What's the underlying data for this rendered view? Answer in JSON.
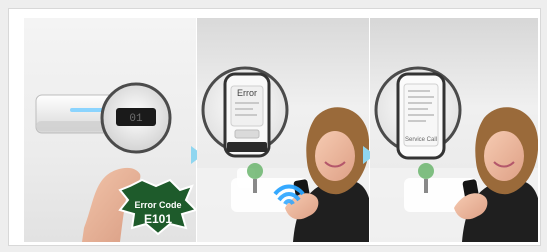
{
  "badge": {
    "line1": "Error Code",
    "line2": "E101"
  },
  "panel2": {
    "magnifier_title": "Error"
  },
  "panel3": {
    "magnifier_footer": "Service Call"
  },
  "display": {
    "readout": "01"
  },
  "colors": {
    "badge_green": "#1e5b2b",
    "badge_text": "#ffffff",
    "badge_code_text": "#ffffff",
    "ac_led_blue": "#7fd0ff",
    "wifi_blue": "#2aa4ff",
    "arrow_blue": "#8fd6f0",
    "hair": "#9a6a3a",
    "sweater": "#1f1f1f"
  }
}
